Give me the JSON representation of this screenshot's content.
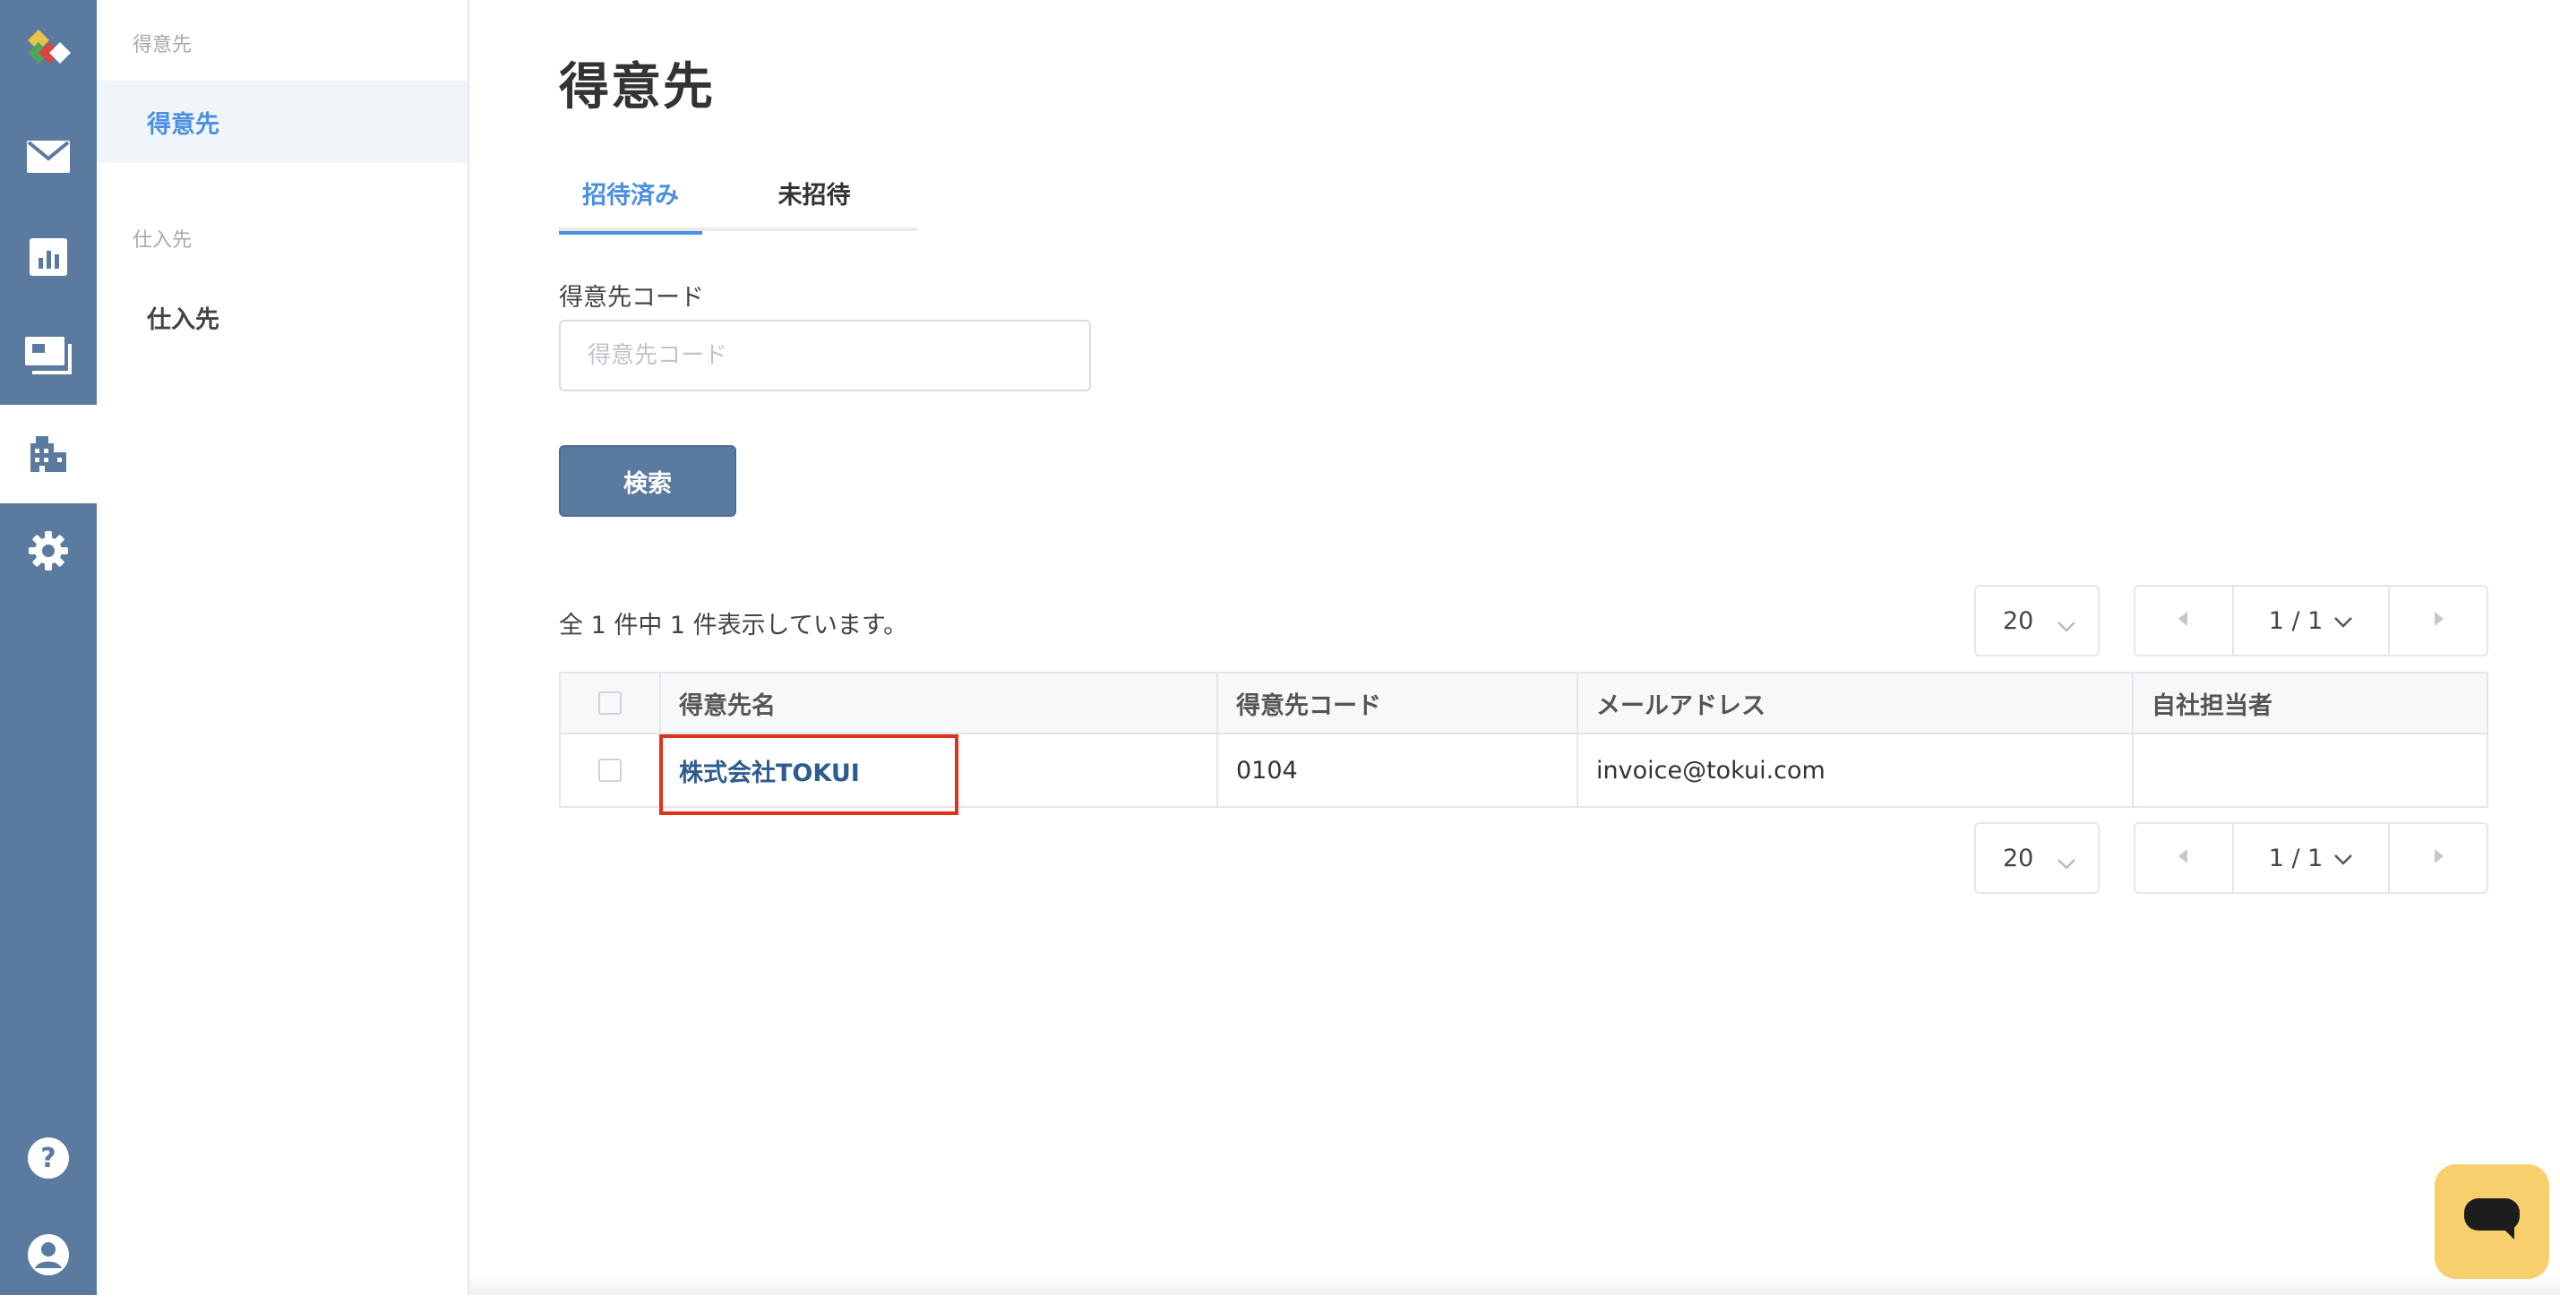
{
  "rail": {
    "items": [
      {
        "icon": "app-logo-icon"
      },
      {
        "icon": "mail-icon"
      },
      {
        "icon": "chart-icon"
      },
      {
        "icon": "payment-icon"
      },
      {
        "icon": "building-icon",
        "active": true
      },
      {
        "icon": "gear-icon"
      },
      {
        "icon": "help-icon"
      },
      {
        "icon": "user-icon"
      }
    ]
  },
  "subnav": {
    "sections": [
      {
        "title": "得意先",
        "items": [
          {
            "label": "得意先",
            "active": true
          }
        ]
      },
      {
        "title": "仕入先",
        "items": [
          {
            "label": "仕入先",
            "active": false
          }
        ]
      }
    ]
  },
  "page": {
    "title": "得意先",
    "tabs": [
      {
        "label": "招待済み",
        "active": true
      },
      {
        "label": "未招待",
        "active": false
      }
    ],
    "filter": {
      "label": "得意先コード",
      "placeholder": "得意先コード",
      "value": ""
    },
    "search_button": "検索",
    "result_count": "全 1 件中 1 件表示しています。",
    "pager": {
      "per_page": "20",
      "current": "1 / 1"
    },
    "table": {
      "columns": [
        "得意先名",
        "得意先コード",
        "メールアドレス",
        "自社担当者"
      ],
      "rows": [
        {
          "name": "株式会社TOKUI",
          "code": "0104",
          "email": "invoice@tokui.com",
          "staff": ""
        }
      ]
    }
  },
  "colors": {
    "rail": "#5b7aa0",
    "accent": "#4a8fe0",
    "link": "#2f5c8f",
    "highlight": "#e0321b",
    "chat": "#f7cf6d"
  }
}
